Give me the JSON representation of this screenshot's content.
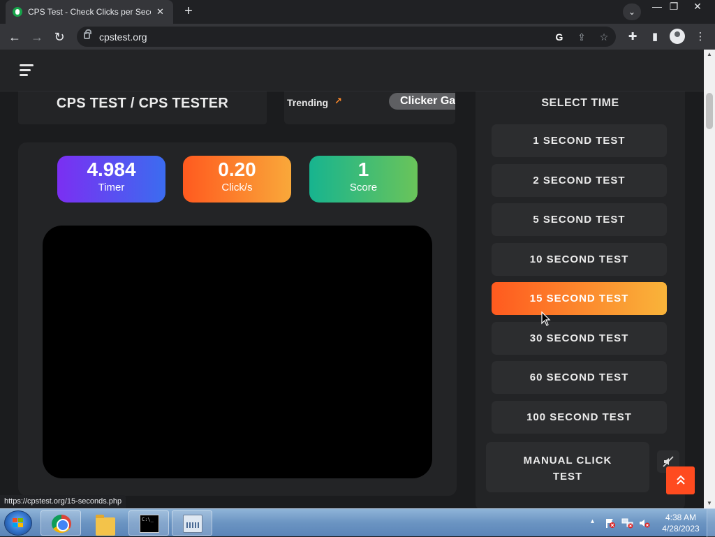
{
  "browser": {
    "tab_title": "CPS Test - Check Clicks per Second",
    "tab_close": "✕",
    "new_tab": "+",
    "tab_search": "⌄",
    "window": {
      "minimize": "—",
      "restore": "❐",
      "close": "✕"
    },
    "nav": {
      "back": "←",
      "forward": "→",
      "reload": "↻"
    },
    "url": "cpstest.org",
    "omnibox_icons": {
      "google": "G",
      "share": "⇪",
      "bookmark": "☆"
    },
    "toolbar_icons": {
      "extensions": "✚",
      "sidepanel": "▮",
      "menu": "⋮"
    }
  },
  "site": {
    "title": "CPS TEST / CPS TESTER",
    "trending_label": "Trending",
    "trending_arrow": "↗",
    "trending_item": "Clicker Game"
  },
  "stats": {
    "timer": {
      "value": "4.984",
      "label": "Timer"
    },
    "clicks": {
      "value": "0.20",
      "label": "Click/s"
    },
    "score": {
      "value": "1",
      "label": "Score"
    }
  },
  "sidebar": {
    "heading": "SELECT TIME",
    "tests": [
      {
        "label": "1 SECOND TEST",
        "active": false
      },
      {
        "label": "2 SECOND TEST",
        "active": false
      },
      {
        "label": "5 SECOND TEST",
        "active": false
      },
      {
        "label": "10 SECOND TEST",
        "active": false
      },
      {
        "label": "15 SECOND TEST",
        "active": true
      },
      {
        "label": "30 SECOND TEST",
        "active": false
      },
      {
        "label": "60 SECOND TEST",
        "active": false
      },
      {
        "label": "100 SECOND TEST",
        "active": false
      }
    ],
    "manual_line1": "MANUAL CLICK",
    "manual_line2": "TEST",
    "mute_icon": "🔇",
    "to_top": "⌃"
  },
  "status_url": "https://cpstest.org/15-seconds.php",
  "taskbar": {
    "tray_up": "▴",
    "time": "4:38 AM",
    "date": "4/28/2023",
    "cmd_text": "C:\\_"
  },
  "colors": {
    "accent_orange": "#ff5a1f",
    "timer_gradient": [
      "#7b2ff2",
      "#3b6cf0"
    ],
    "score_gradient": [
      "#17b48f",
      "#6ac45a"
    ]
  }
}
